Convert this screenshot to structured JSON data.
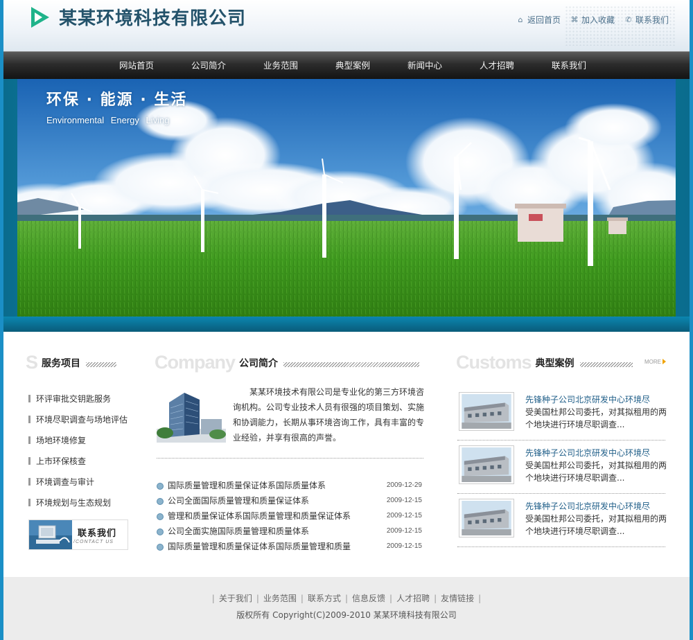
{
  "header": {
    "logo_text": "某某环境科技有限公司",
    "links": [
      {
        "label": "返回首页",
        "icon": "home-icon"
      },
      {
        "label": "加入收藏",
        "icon": "bookmark-icon"
      },
      {
        "label": "联系我们",
        "icon": "contact-icon"
      }
    ]
  },
  "nav": {
    "items": [
      "网站首页",
      "公司简介",
      "业务范围",
      "典型案例",
      "新闻中心",
      "人才招聘",
      "联系我们"
    ]
  },
  "banner": {
    "slogan_cn": "环保 · 能源 · 生活",
    "slogan_en": "Environmental  Energy  Living"
  },
  "services": {
    "big_letter": "S",
    "title": "服务项目",
    "items": [
      "环评审批交钥匙服务",
      "环境尽职调查与场地评估",
      "场地环境修复",
      "上市环保核查",
      "环境调查与审计",
      "环境规划与生态规划"
    ],
    "contact_banner": {
      "cn": "联系我们",
      "en": "/CONTACT US"
    }
  },
  "company": {
    "big_en": "Company",
    "title": "公司简介",
    "intro": "某某环境技术有限公司是专业化的第三方环境咨询机构。公司专业技术人员有很强的项目策划、实施和协调能力，长期从事环境咨询工作，具有丰富的专业经验，并享有很高的声誉。",
    "news": [
      {
        "title": "国际质量管理和质量保证体系国际质量体系",
        "date": "2009-12-29"
      },
      {
        "title": "公司全面国际质量管理和质量保证体系",
        "date": "2009-12-15"
      },
      {
        "title": "管理和质量保证体系国际质量管理和质量保证体系",
        "date": "2009-12-15"
      },
      {
        "title": "公司全面实施国际质量管理和质量体系",
        "date": "2009-12-15"
      },
      {
        "title": "国际质量管理和质量保证体系国际质量管理和质量",
        "date": "2009-12-15"
      }
    ]
  },
  "cases": {
    "big_en": "Customs",
    "title": "典型案例",
    "more": "MORE",
    "items": [
      {
        "title": "先锋种子公司北京研发中心环境尽",
        "desc": "受美国杜邦公司委托，对其拟租用的两个地块进行环境尽职调查..."
      },
      {
        "title": "先锋种子公司北京研发中心环境尽",
        "desc": "受美国杜邦公司委托，对其拟租用的两个地块进行环境尽职调查..."
      },
      {
        "title": "先锋种子公司北京研发中心环境尽",
        "desc": "受美国杜邦公司委托，对其拟租用的两个地块进行环境尽职调查..."
      }
    ]
  },
  "footer": {
    "links": [
      "关于我们",
      "业务范围",
      "联系方式",
      "信息反馈",
      "人才招聘",
      "友情链接"
    ],
    "copyright": "版权所有 Copyright(C)2009-2010 某某环境科技有限公司"
  },
  "colors": {
    "brand": "#24536b",
    "accent": "#1b8fc6",
    "logo_green": "#1fb38a",
    "case_title": "#1f5e88"
  }
}
